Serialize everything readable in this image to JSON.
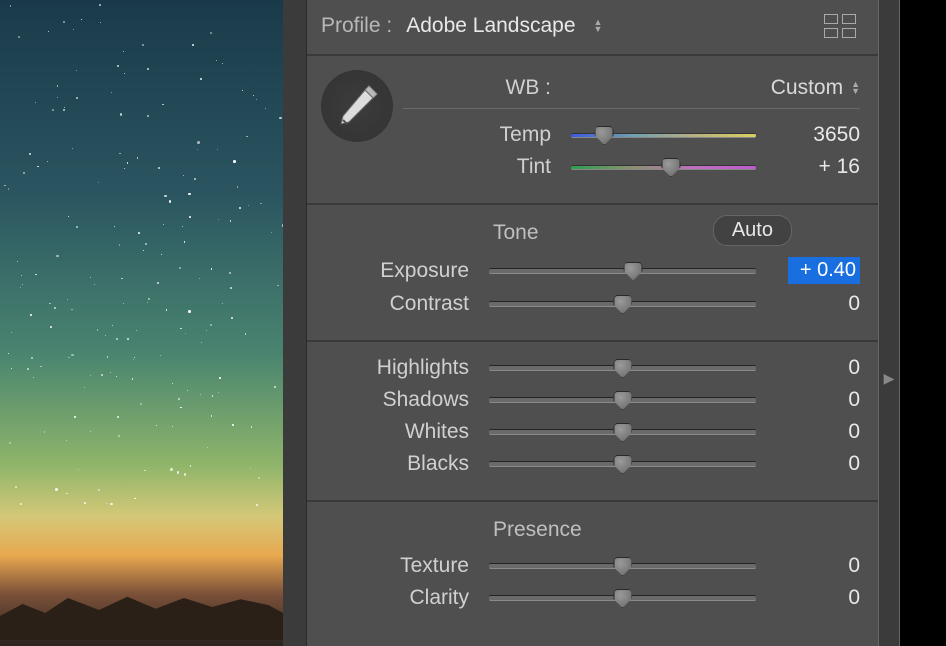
{
  "profile": {
    "label": "Profile :",
    "value": "Adobe Landscape"
  },
  "wb": {
    "label": "WB :",
    "value": "Custom",
    "temp": {
      "label": "Temp",
      "value": "3650",
      "pos": 18
    },
    "tint": {
      "label": "Tint",
      "value": "+ 16",
      "pos": 54
    }
  },
  "tone": {
    "heading": "Tone",
    "auto": "Auto",
    "exposure": {
      "label": "Exposure",
      "value": "+ 0.40",
      "pos": 54
    },
    "contrast": {
      "label": "Contrast",
      "value": "0",
      "pos": 50
    }
  },
  "hlsw": {
    "highlights": {
      "label": "Highlights",
      "value": "0",
      "pos": 50
    },
    "shadows": {
      "label": "Shadows",
      "value": "0",
      "pos": 50
    },
    "whites": {
      "label": "Whites",
      "value": "0",
      "pos": 50
    },
    "blacks": {
      "label": "Blacks",
      "value": "0",
      "pos": 50
    }
  },
  "presence": {
    "heading": "Presence",
    "texture": {
      "label": "Texture",
      "value": "0",
      "pos": 50
    },
    "clarity": {
      "label": "Clarity",
      "value": "0",
      "pos": 50
    }
  }
}
